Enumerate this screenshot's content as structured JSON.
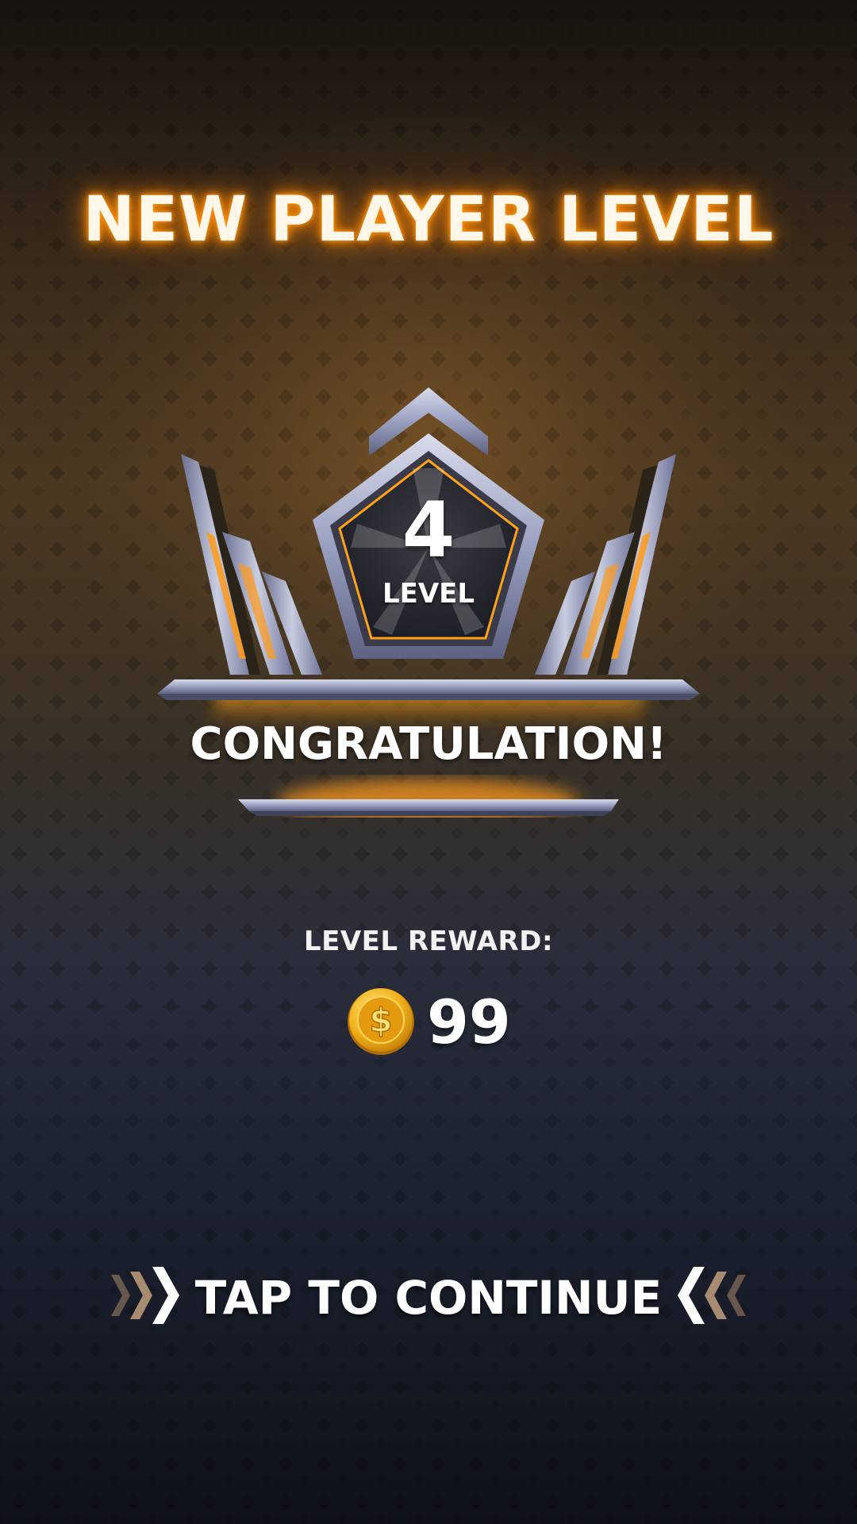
{
  "screen": {
    "title": "NEW PLAYER LEVEL",
    "accent_color": "#ff8a00"
  },
  "badge": {
    "level_number": "4",
    "level_label": "LEVEL",
    "congrats_text": "CONGRATULATION!"
  },
  "reward": {
    "label": "LEVEL REWARD:",
    "icon": "gold-coin-icon",
    "amount": "99",
    "coin_color": "#f2b21c"
  },
  "continue": {
    "label": "TAP TO CONTINUE",
    "left_icon": "triple-chevron-right-icon",
    "right_icon": "triple-chevron-left-icon"
  }
}
